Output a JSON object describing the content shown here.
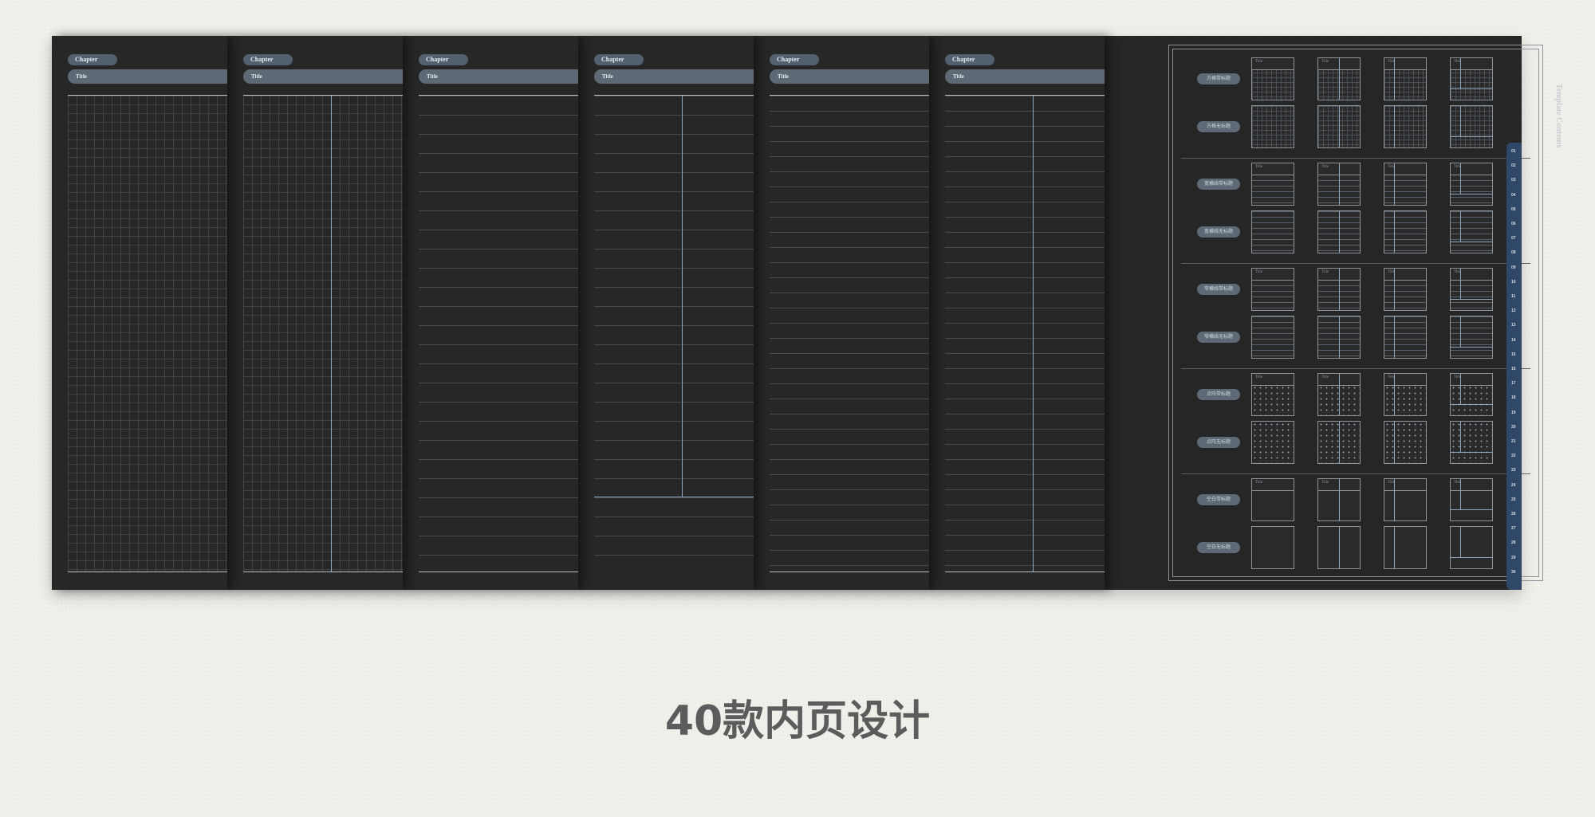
{
  "pages": [
    {
      "chapter": "Chapter",
      "title": "Title",
      "style": "grid"
    },
    {
      "chapter": "Chapter",
      "title": "Title",
      "style": "grid-divided"
    },
    {
      "chapter": "Chapter",
      "title": "Title",
      "style": "lined"
    },
    {
      "chapter": "Chapter",
      "title": "Title",
      "style": "lined-divided"
    },
    {
      "chapter": "Chapter",
      "title": "Title",
      "style": "lined-narrow"
    },
    {
      "chapter": "Chapter",
      "title": "Title",
      "style": "lined-narrow-divided"
    }
  ],
  "template_contents": {
    "side_title": "Template Contents",
    "rows": [
      {
        "label": "方格带标题",
        "pattern": "grid",
        "has_title": true
      },
      {
        "label": "方格无标题",
        "pattern": "grid",
        "has_title": false
      },
      {
        "label": "宽横线带标题",
        "pattern": "lines",
        "has_title": true
      },
      {
        "label": "宽横线无标题",
        "pattern": "lines",
        "has_title": false
      },
      {
        "label": "窄横线带标题",
        "pattern": "lines",
        "has_title": true
      },
      {
        "label": "窄横线无标题",
        "pattern": "lines",
        "has_title": false
      },
      {
        "label": "点阵带标题",
        "pattern": "dots",
        "has_title": true
      },
      {
        "label": "点阵无标题",
        "pattern": "dots",
        "has_title": false
      },
      {
        "label": "空白带标题",
        "pattern": "blank",
        "has_title": true
      },
      {
        "label": "空白无标题",
        "pattern": "blank",
        "has_title": false
      }
    ],
    "thumb_title": "Title"
  },
  "tab_numbers": [
    "01",
    "02",
    "03",
    "04",
    "05",
    "06",
    "07",
    "08",
    "09",
    "10",
    "11",
    "12",
    "13",
    "14",
    "15",
    "16",
    "17",
    "18",
    "19",
    "20",
    "21",
    "22",
    "23",
    "24",
    "25",
    "26",
    "27",
    "28",
    "29",
    "30"
  ],
  "headline": "40款内页设计",
  "colors": {
    "board": "#262626",
    "accent_blue": "#2f4868",
    "pill": "#5d6a76",
    "background": "#f1efea"
  }
}
